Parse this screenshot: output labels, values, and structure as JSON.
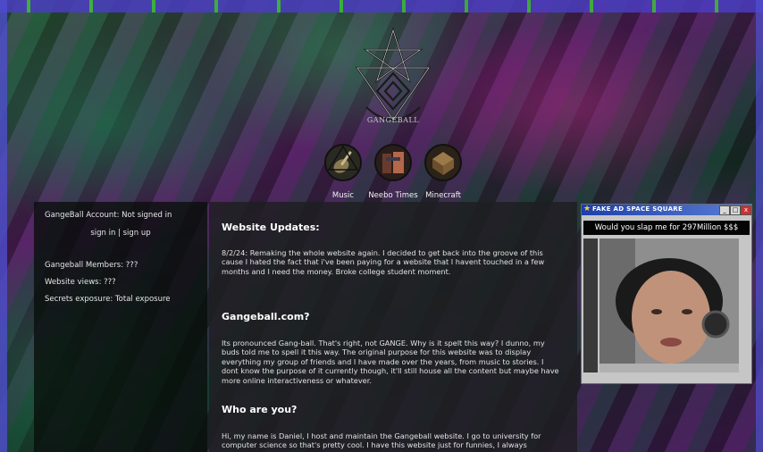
{
  "logo": {
    "text": "GANGEBALL"
  },
  "nav": {
    "items": [
      {
        "label": "Music",
        "icon": "guitar-icon"
      },
      {
        "label": "Neebo Times",
        "icon": "newspaper-icon"
      },
      {
        "label": "Minecraft",
        "icon": "minecraft-icon"
      }
    ]
  },
  "sidebar": {
    "account_label": "GangeBall Account: Not signed in",
    "sign_in": "sign in",
    "separator": "|",
    "sign_up": "sign up",
    "members": "Gangeball Members: ???",
    "views": "Website views: ???",
    "secrets": "Secrets exposure: Total exposure"
  },
  "main": {
    "updates_heading": "Website Updates:",
    "updates_text": "8/2/24: Remaking the whole website again. I decided to get back into the groove of this cause I hated the fact that i've been paying for a website that I havent touched in a few months and I need the money. Broke college student moment.",
    "about_heading": "Gangeball.com?",
    "about_text": "Its pronounced Gang-ball. That's right, not GANGE. Why is it spelt this way? I dunno, my buds told me to spell it this way. The original purpose for this website was to display everything my group of friends and I have made over the years, from music to stories. I dont know the purpose of it currently though, it'll still house all the content but maybe have more online interactiveness or whatever.",
    "who_heading": "Who are you?",
    "who_text": "Hi, my name is Daniel, I host and maintain the Gangeball website. I go to university for computer science so that's pretty cool. I have this website just for funnies, I always"
  },
  "ad": {
    "title": "FAKE AD SPACE SQUARE",
    "caption": "Would you slap me for 297Million $$$",
    "minimize": "_",
    "maximize": "□",
    "close": "x"
  },
  "colors": {
    "ad_titlebar": "#1d3fa8",
    "close_button": "#d03030"
  }
}
